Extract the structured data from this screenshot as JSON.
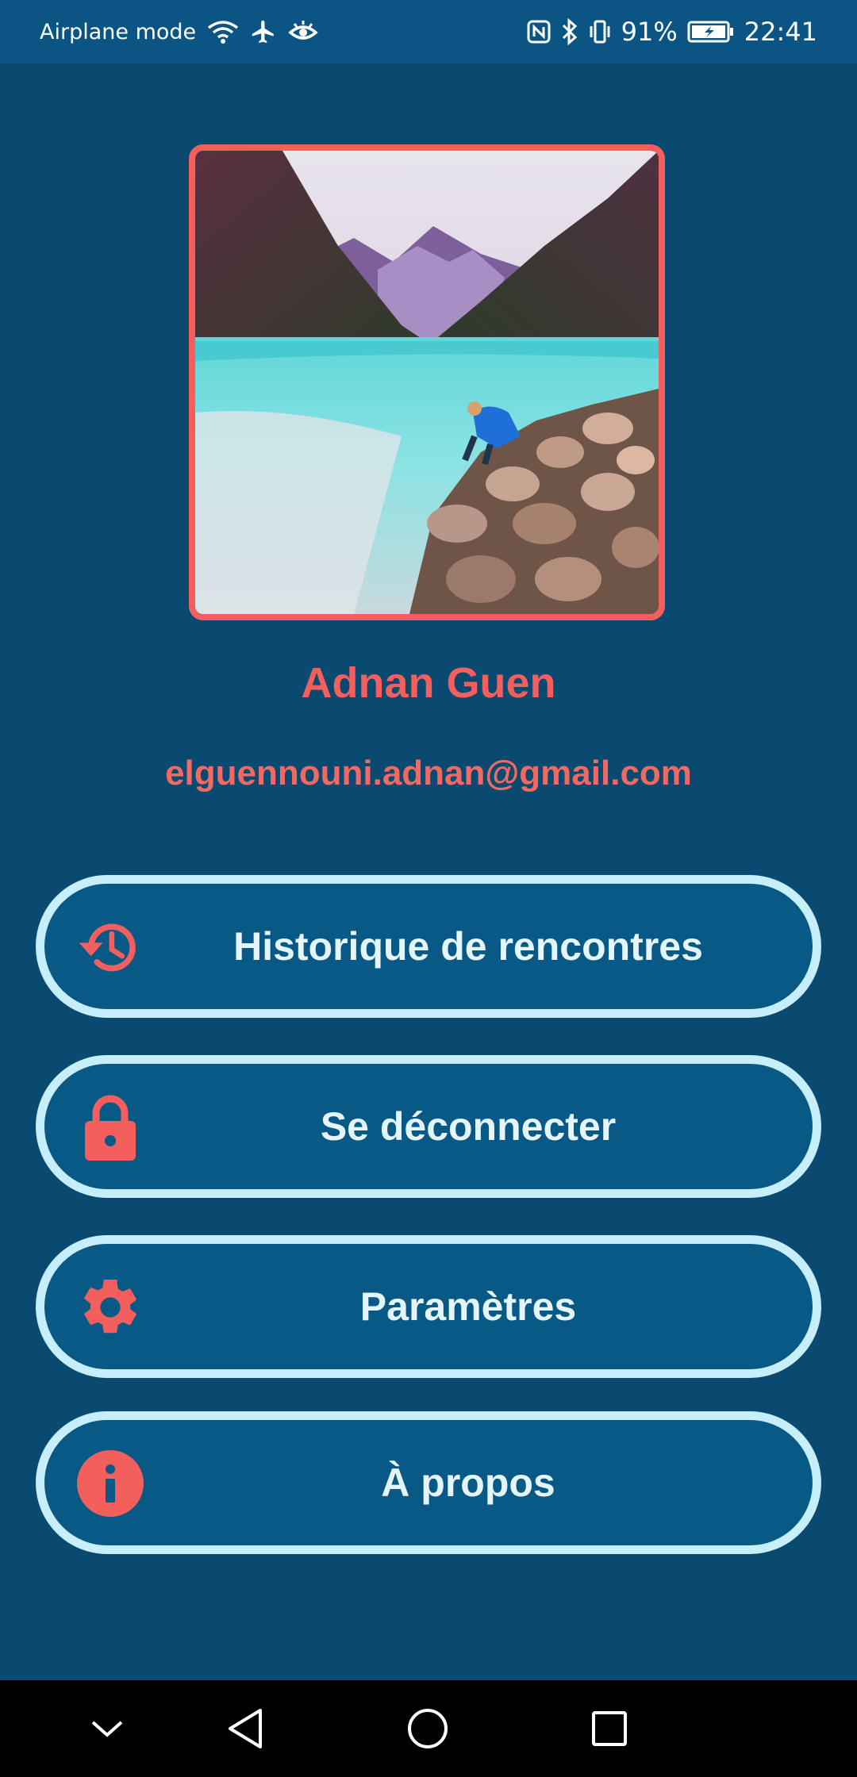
{
  "status_bar": {
    "mode_text": "Airplane mode",
    "battery_percent": "91%",
    "time": "22:41",
    "icons": [
      "wifi-icon",
      "airplane-icon",
      "eye-icon",
      "nfc-icon",
      "bluetooth-icon",
      "vibrate-icon",
      "battery-charging-icon"
    ]
  },
  "profile": {
    "photo": "profile-photo-lake",
    "name": "Adnan Guen",
    "email": "elguennouni.adnan@gmail.com"
  },
  "menu": [
    {
      "label": "Historique de rencontres",
      "icon": "history-icon"
    },
    {
      "label": "Se déconnecter",
      "icon": "lock-icon"
    },
    {
      "label": "Paramètres",
      "icon": "gear-icon"
    },
    {
      "label": "À propos",
      "icon": "info-icon"
    }
  ],
  "nav_bar": {
    "icons": [
      "collapse-chevron-icon",
      "back-icon",
      "home-icon",
      "recents-icon"
    ]
  },
  "colors": {
    "background": "#0a4a70",
    "status_bar": "#0b5584",
    "accent": "#f25f5c",
    "button_fill": "#085986",
    "button_border": "#c7effb",
    "button_text": "#e4f6fb"
  }
}
